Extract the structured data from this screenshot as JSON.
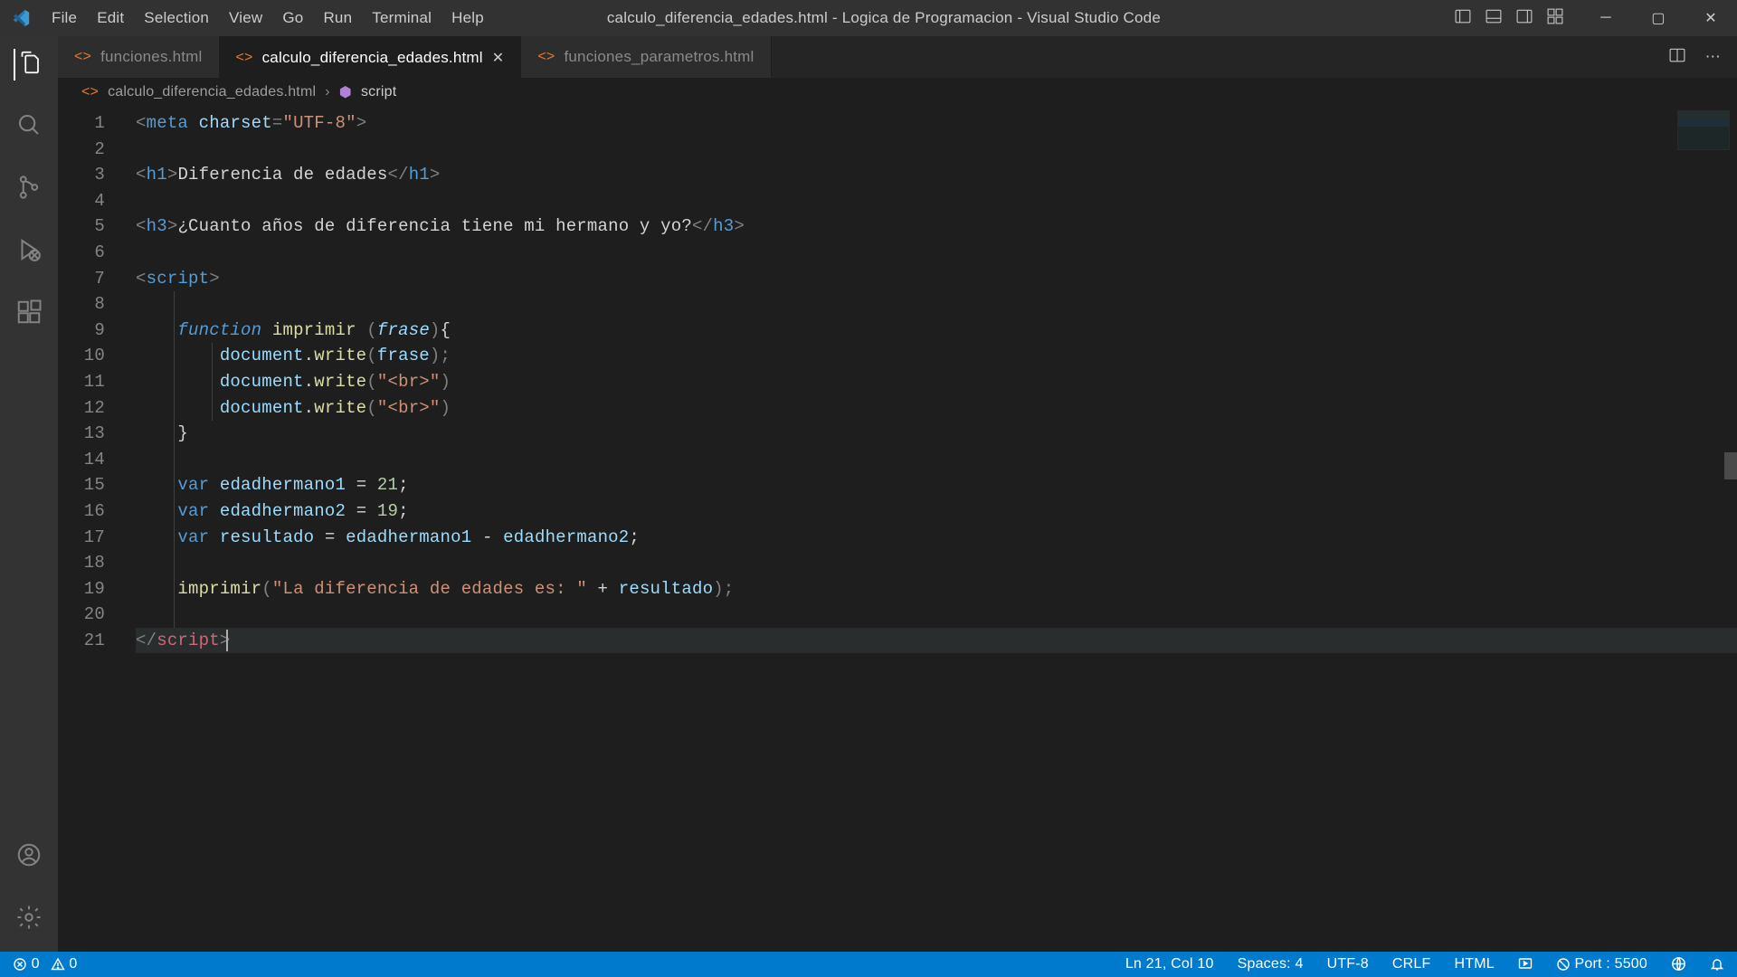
{
  "menu": [
    "File",
    "Edit",
    "Selection",
    "View",
    "Go",
    "Run",
    "Terminal",
    "Help"
  ],
  "window_title": "calculo_diferencia_edades.html - Logica de Programacion - Visual Studio Code",
  "tabs": [
    {
      "label": "funciones.html",
      "active": false,
      "closable": false
    },
    {
      "label": "calculo_diferencia_edades.html",
      "active": true,
      "closable": true
    },
    {
      "label": "funciones_parametros.html",
      "active": false,
      "closable": false
    }
  ],
  "breadcrumb": {
    "file": "calculo_diferencia_edades.html",
    "symbol": "script"
  },
  "code_lines": 21,
  "status": {
    "errors": "0",
    "warnings": "0",
    "cursor": "Ln 21, Col 10",
    "spaces": "Spaces: 4",
    "encoding": "UTF-8",
    "eol": "CRLF",
    "lang": "HTML",
    "port": "Port : 5500"
  }
}
